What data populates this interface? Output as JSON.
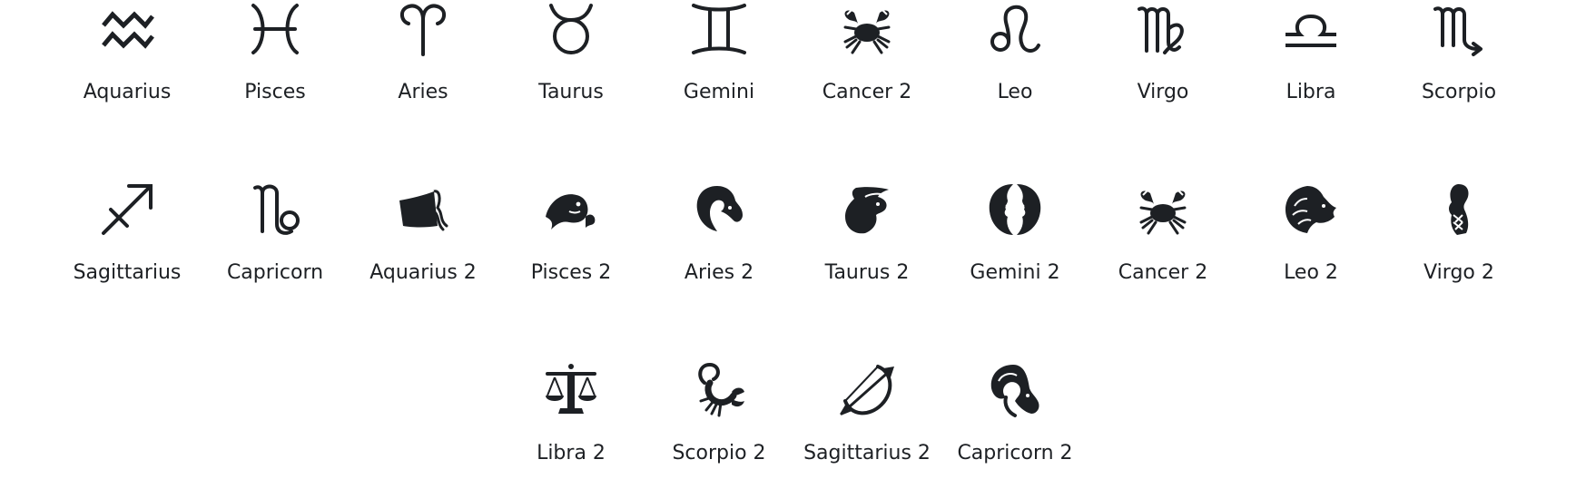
{
  "rows": [
    {
      "items": [
        {
          "label": "Aquarius",
          "icon": "aquarius-icon",
          "glyph": "♒"
        },
        {
          "label": "Pisces",
          "icon": "pisces-icon",
          "glyph": "♓"
        },
        {
          "label": "Aries",
          "icon": "aries-icon",
          "glyph": "♈"
        },
        {
          "label": "Taurus",
          "icon": "taurus-icon",
          "glyph": "♉"
        },
        {
          "label": "Gemini",
          "icon": "gemini-icon",
          "glyph": "♊"
        },
        {
          "label": "Cancer 2",
          "icon": "cancer-crab-icon",
          "glyph": "🦀"
        },
        {
          "label": "Leo",
          "icon": "leo-icon",
          "glyph": "♌"
        },
        {
          "label": "Virgo",
          "icon": "virgo-icon",
          "glyph": "♍"
        },
        {
          "label": "Libra",
          "icon": "libra-icon",
          "glyph": "♎"
        },
        {
          "label": "Scorpio",
          "icon": "scorpio-icon",
          "glyph": "♏"
        }
      ]
    },
    {
      "items": [
        {
          "label": "Sagittarius",
          "icon": "sagittarius-icon",
          "glyph": "♐"
        },
        {
          "label": "Capricorn",
          "icon": "capricorn-icon",
          "glyph": "♑"
        },
        {
          "label": "Aquarius 2",
          "icon": "aquarius-jar-icon",
          "glyph": "⛁"
        },
        {
          "label": "Pisces 2",
          "icon": "pisces-fish-icon",
          "glyph": "🐟"
        },
        {
          "label": "Aries 2",
          "icon": "aries-ram-head-icon",
          "glyph": "♈"
        },
        {
          "label": "Taurus 2",
          "icon": "taurus-bull-head-icon",
          "glyph": "♉"
        },
        {
          "label": "Gemini 2",
          "icon": "gemini-twins-faces-icon",
          "glyph": "♊"
        },
        {
          "label": "Cancer 2",
          "icon": "cancer-crab-icon",
          "glyph": "🦀"
        },
        {
          "label": "Leo 2",
          "icon": "leo-lion-head-icon",
          "glyph": "♌"
        },
        {
          "label": "Virgo 2",
          "icon": "virgo-maiden-icon",
          "glyph": "♍"
        }
      ]
    },
    {
      "items": [
        {
          "label": "Libra 2",
          "icon": "libra-scales-icon",
          "glyph": "⚖"
        },
        {
          "label": "Scorpio 2",
          "icon": "scorpio-scorpion-icon",
          "glyph": "🦂"
        },
        {
          "label": "Sagittarius 2",
          "icon": "sagittarius-bow-arrow-icon",
          "glyph": "🏹"
        },
        {
          "label": "Capricorn 2",
          "icon": "capricorn-goat-head-icon",
          "glyph": "♑"
        }
      ]
    }
  ]
}
